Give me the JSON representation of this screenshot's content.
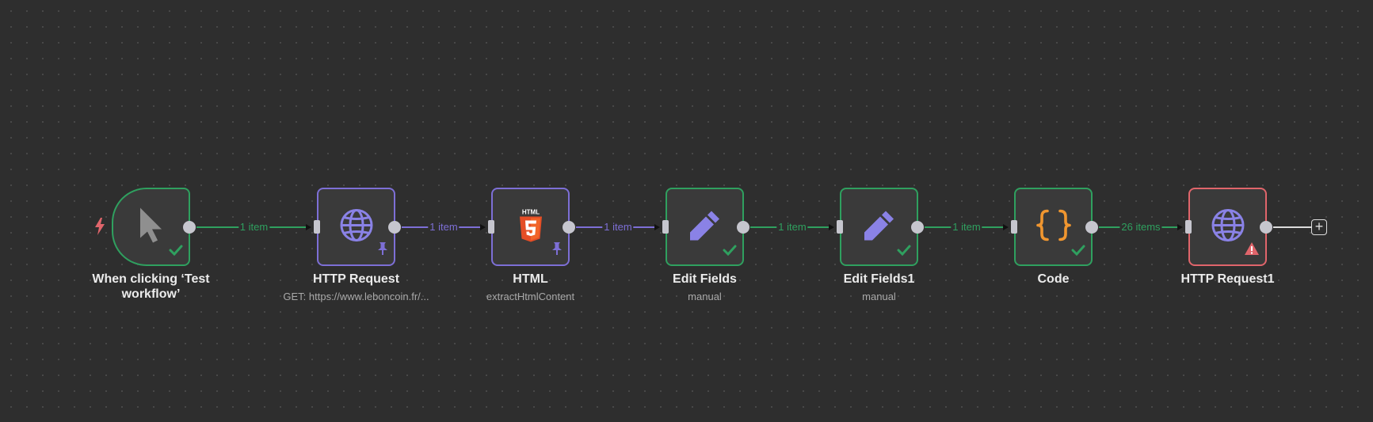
{
  "colors": {
    "success": "#2fa05f",
    "pinned": "#7d6fd6",
    "error": "#e0656b",
    "handle": "#c6c6ce"
  },
  "nodes": [
    {
      "title": "When clicking ‘Test workflow’",
      "subtitle": "",
      "icon": "cursor-icon",
      "status": "success"
    },
    {
      "title": "HTTP Request",
      "subtitle": "GET: https://www.leboncoin.fr/...",
      "icon": "globe-icon",
      "status": "pinned"
    },
    {
      "title": "HTML",
      "subtitle": "extractHtmlContent",
      "icon": "html5-icon",
      "icon_text": "HTML",
      "status": "pinned"
    },
    {
      "title": "Edit Fields",
      "subtitle": "manual",
      "icon": "pencil-icon",
      "status": "success"
    },
    {
      "title": "Edit Fields1",
      "subtitle": "manual",
      "icon": "pencil-icon",
      "status": "success"
    },
    {
      "title": "Code",
      "subtitle": "",
      "icon": "braces-icon",
      "status": "success"
    },
    {
      "title": "HTTP Request1",
      "subtitle": "",
      "icon": "globe-icon",
      "status": "error"
    }
  ],
  "connections": [
    {
      "label": "1 item",
      "style": "success"
    },
    {
      "label": "1 item",
      "style": "pinned"
    },
    {
      "label": "1 item",
      "style": "pinned"
    },
    {
      "label": "1 item",
      "style": "success"
    },
    {
      "label": "1 item",
      "style": "success"
    },
    {
      "label": "26 items",
      "style": "success"
    }
  ],
  "add_button": {
    "symbol": "+"
  }
}
